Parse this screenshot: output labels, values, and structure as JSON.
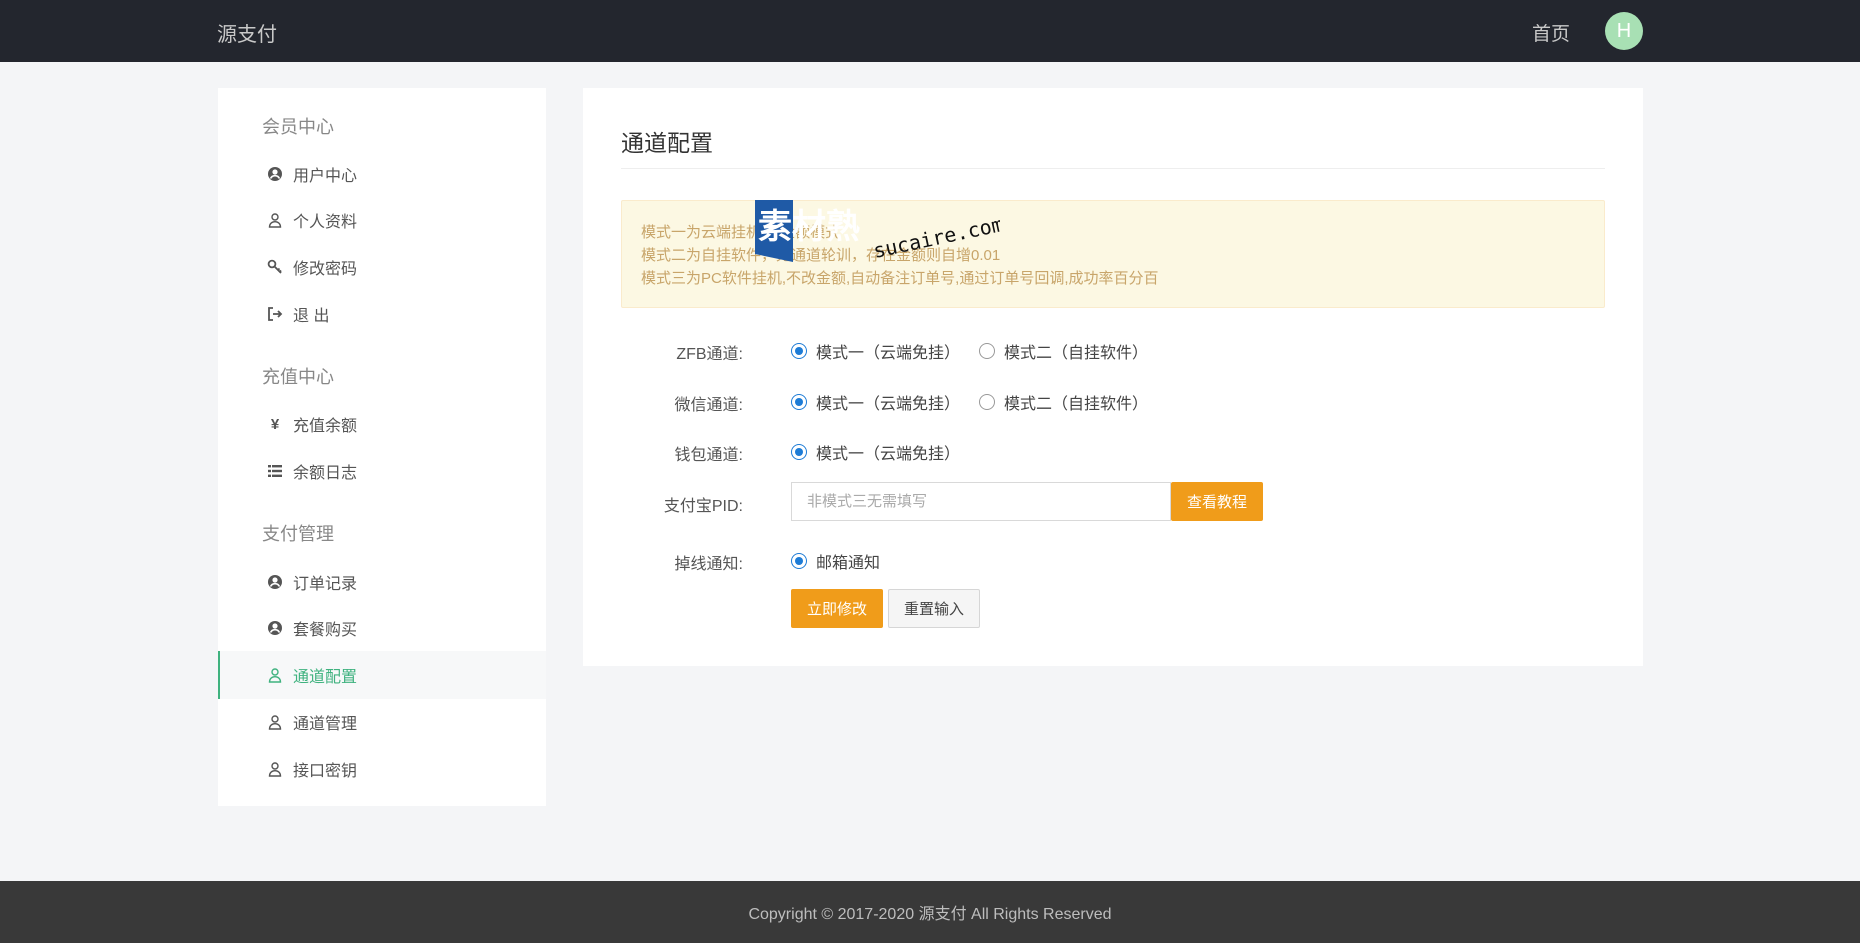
{
  "header": {
    "brand": "源支付",
    "home_link": "首页",
    "avatar_letter": "H"
  },
  "sidebar": {
    "groups": [
      {
        "title": "会员中心",
        "items": [
          {
            "label": "用户中心",
            "icon": "user-circle-icon"
          },
          {
            "label": "个人资料",
            "icon": "user-outline-icon"
          },
          {
            "label": "修改密码",
            "icon": "key-icon"
          },
          {
            "label": "退 出",
            "icon": "logout-icon"
          }
        ]
      },
      {
        "title": "充值中心",
        "items": [
          {
            "label": "充值余额",
            "icon": "yen-icon"
          },
          {
            "label": "余额日志",
            "icon": "list-icon"
          }
        ]
      },
      {
        "title": "支付管理",
        "items": [
          {
            "label": "订单记录",
            "icon": "user-circle-icon"
          },
          {
            "label": "套餐购买",
            "icon": "user-circle-icon"
          },
          {
            "label": "通道配置",
            "icon": "user-outline-icon",
            "active": true
          },
          {
            "label": "通道管理",
            "icon": "user-outline-icon"
          },
          {
            "label": "接口密钥",
            "icon": "user-outline-icon"
          }
        ]
      }
    ]
  },
  "main": {
    "title": "通道配置",
    "notice": [
      "模式一为云端挂机,改金额模式",
      "模式二为自挂软件，无通道轮训，存在金额则自增0.01",
      "模式三为PC软件挂机,不改金额,自动备注订单号,通过订单号回调,成功率百分百"
    ],
    "form": {
      "zfb_label": "ZFB通道:",
      "wechat_label": "微信通道:",
      "wallet_label": "钱包通道:",
      "pid_label": "支付宝PID:",
      "offline_label": "掉线通知:",
      "mode1": "模式一（云端免挂）",
      "mode2": "模式二（自挂软件）",
      "pid_placeholder": "非模式三无需填写",
      "tutorial_button": "查看教程",
      "email_notify": "邮箱通知",
      "submit_button": "立即修改",
      "reset_button": "重置输入"
    }
  },
  "watermark": {
    "cn": "素材熟",
    "en": "sucaire.com"
  },
  "footer": {
    "copyright": "Copyright © 2017-2020 源支付 All Rights Reserved"
  },
  "colors": {
    "accent_green": "#3fb27f",
    "button_orange": "#f09c1a",
    "radio_blue": "#1e7cd6",
    "topbar": "#23262e",
    "footer": "#393939"
  }
}
